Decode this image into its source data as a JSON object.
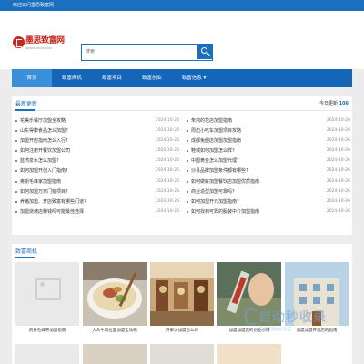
{
  "topbar": {
    "welcome": "欢迎访问墨思致富网"
  },
  "logo": {
    "name": "墨思致富网",
    "url": "www.mosisi.com"
  },
  "search": {
    "placeholder": "搜索",
    "value": ""
  },
  "nav": [
    {
      "label": "首页",
      "active": true
    },
    {
      "label": "致富商机",
      "active": false
    },
    {
      "label": "致富项目",
      "active": false
    },
    {
      "label": "致富创业",
      "active": false
    },
    {
      "label": "致富信息 ▾",
      "active": false
    }
  ],
  "latest": {
    "title": "最新更新",
    "today_label": "今日更新",
    "today_count": "106",
    "left": [
      {
        "text": "花美乐餐厅加盟全攻略",
        "date": "2024-10-26"
      },
      {
        "text": "山东得康食品怎么加盟?",
        "date": "2024-10-26"
      },
      {
        "text": "加盟开店指南怎么入行?",
        "date": "2024-10-26"
      },
      {
        "text": "如何注册开餐饮加盟公司",
        "date": "2024-10-26"
      },
      {
        "text": "蓝湾泉水怎么加盟?",
        "date": "2024-10-26"
      },
      {
        "text": "如何加盟开创入门指南?",
        "date": "2024-10-26"
      },
      {
        "text": "奥斯毛峰家加盟指南",
        "date": "2024-10-26"
      },
      {
        "text": "如何加盟万家门窗项目?",
        "date": "2024-10-26"
      },
      {
        "text": "养猪加盟、开店致富有哪些门道?",
        "date": "2024-10-26"
      },
      {
        "text": "加盟烧烤店赚钱吗可能最佳选择",
        "date": "2024-10-26"
      }
    ],
    "right": [
      {
        "text": "朱莉的花店加盟指南",
        "date": "2024-10-26"
      },
      {
        "text": "周边小吃车加盟项目攻略",
        "date": "2024-10-26"
      },
      {
        "text": "成都兔腿店加盟加盟指南",
        "date": "2024-10-26"
      },
      {
        "text": "鞋城如何加盟怎么样?",
        "date": "2024-10-26"
      },
      {
        "text": "中国黄金怎么加盟代理?",
        "date": "2024-10-26"
      },
      {
        "text": "沙县品牌加盟条件都有哪些?",
        "date": "2024-10-26"
      },
      {
        "text": "如何做好加盟餐饮店加盟优质指南",
        "date": "2024-10-26"
      },
      {
        "text": "商业造型加盟可靠吗?",
        "date": "2024-10-26"
      },
      {
        "text": "如何加盟开元加盟指南?",
        "date": "2024-10-26"
      },
      {
        "text": "如何找到可靠的服装中介加盟指南",
        "date": "2024-10-26"
      }
    ]
  },
  "business": {
    "title": "致富商机",
    "cards": [
      {
        "caption": "费县毛峰茶加盟指南"
      },
      {
        "caption": "大众牛肉拉面加盟全攻略"
      },
      {
        "caption": "开果坊加盟怎么样"
      },
      {
        "caption": "加盟加盟店的创业心得"
      },
      {
        "caption": "加盟加盟开酒店的指南"
      }
    ]
  },
  "watermark": {
    "brand": "自动秒收录",
    "sub": "技术交流站长论坛"
  },
  "colors": {
    "accent": "#1a6fbf",
    "nav": "#1565b8",
    "nav_active": "#3a8fd9",
    "logo": "#c8281e"
  }
}
